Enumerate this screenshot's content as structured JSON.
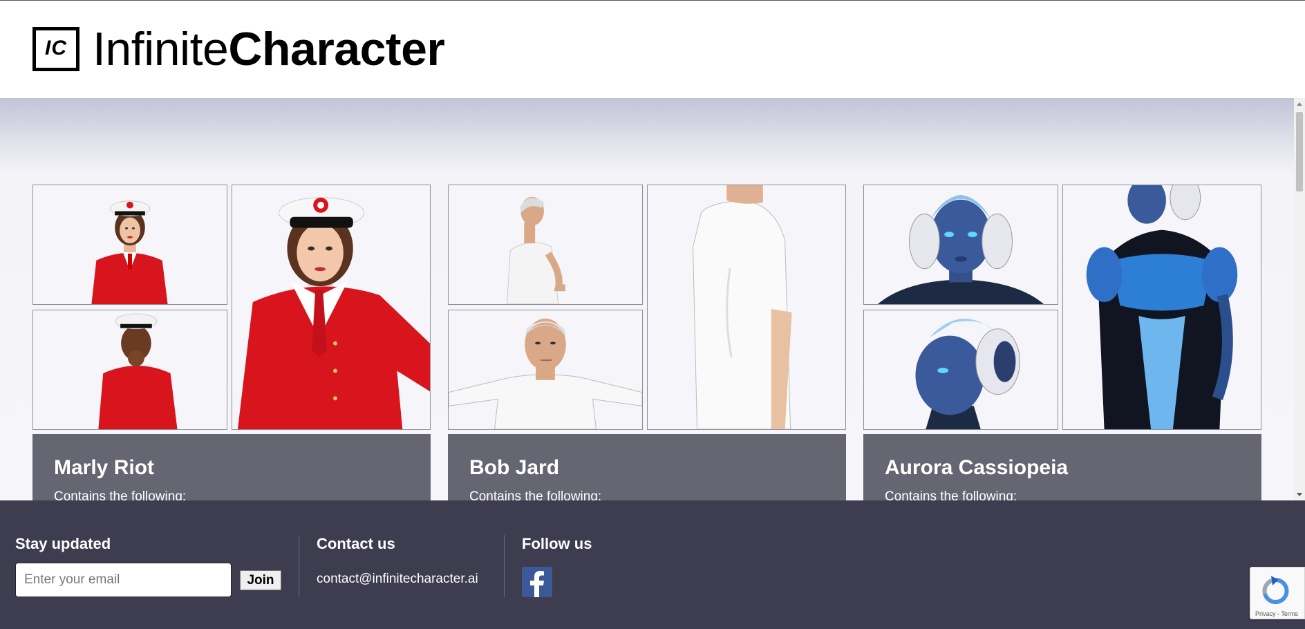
{
  "header": {
    "logo_mark": "IC",
    "brand_light": "Infinite",
    "brand_bold": "Character"
  },
  "cards": [
    {
      "name": "Marly Riot",
      "description": "Contains the following:"
    },
    {
      "name": "Bob Jard",
      "description": "Contains the following:"
    },
    {
      "name": "Aurora Cassiopeia",
      "description": "Contains the following:"
    }
  ],
  "footer": {
    "stay_updated": {
      "heading": "Stay updated",
      "email_placeholder": "Enter your email",
      "join_label": "Join"
    },
    "contact": {
      "heading": "Contact us",
      "email": "contact@infinitecharacter.ai"
    },
    "follow": {
      "heading": "Follow us",
      "icons": [
        "facebook-icon"
      ]
    }
  },
  "recaptcha": {
    "legal": "Privacy - Terms"
  },
  "colors": {
    "card_info_bg": "#666673",
    "footer_bg": "#3e3d4f",
    "facebook_blue": "#3b5998"
  }
}
